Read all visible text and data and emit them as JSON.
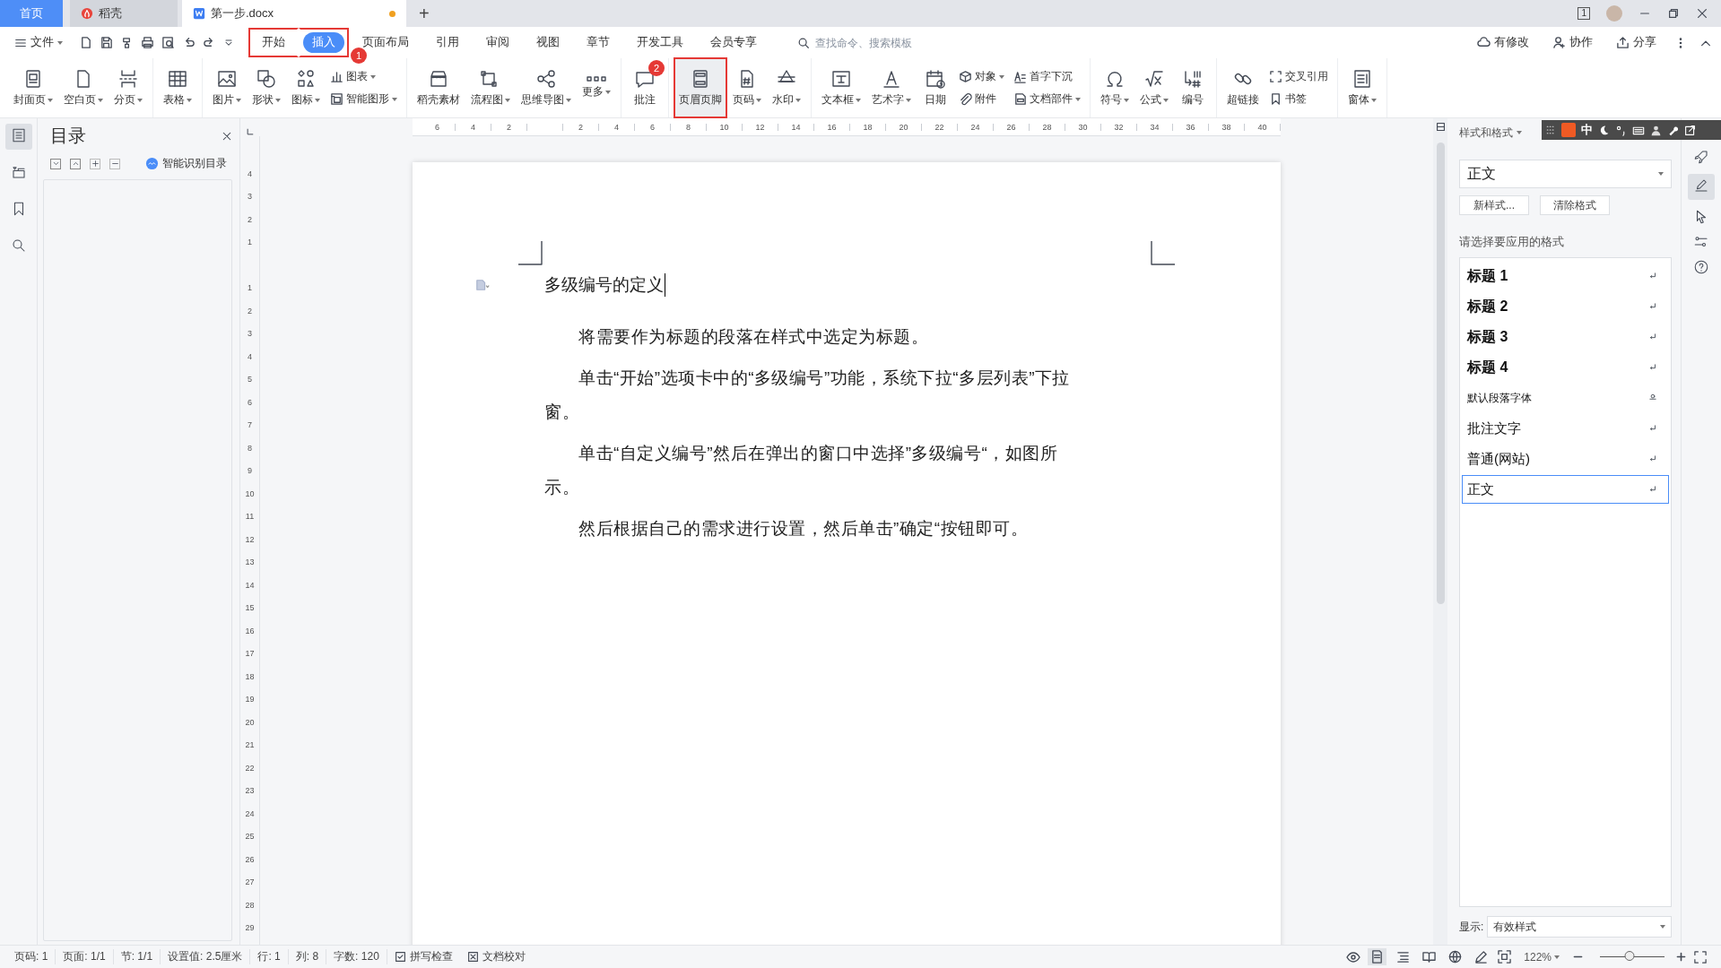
{
  "tabs": [
    {
      "label": "首页",
      "kind": "home",
      "selected": false
    },
    {
      "label": "稻壳",
      "kind": "docer",
      "selected": false
    },
    {
      "label": "第一步.docx",
      "kind": "document",
      "selected": true,
      "unsaved": true
    }
  ],
  "new_tab": "+",
  "window_controls": {
    "badge": "1"
  },
  "menu": {
    "file": "文件",
    "tabs": [
      {
        "label": "开始",
        "selected": false,
        "boxed": true
      },
      {
        "label": "插入",
        "selected": true,
        "boxed": true,
        "badge": "1"
      },
      {
        "label": "页面布局",
        "selected": false,
        "boxed": false
      },
      {
        "label": "引用",
        "selected": false,
        "boxed": false
      },
      {
        "label": "审阅",
        "selected": false,
        "boxed": false
      },
      {
        "label": "视图",
        "selected": false,
        "boxed": false
      },
      {
        "label": "章节",
        "selected": false,
        "boxed": false
      },
      {
        "label": "开发工具",
        "selected": false,
        "boxed": false
      },
      {
        "label": "会员专享",
        "selected": false,
        "boxed": false
      }
    ],
    "search": {
      "placeholder": "查找命令、搜索模板"
    },
    "actions": [
      "有修改",
      "协作",
      "分享"
    ]
  },
  "toolbar": [
    [
      {
        "kind": "large",
        "label": "封面页",
        "dropdown": true,
        "boxed": false
      },
      {
        "kind": "large",
        "label": "空白页",
        "dropdown": true,
        "boxed": false
      },
      {
        "kind": "large",
        "label": "分页",
        "dropdown": true,
        "boxed": false
      }
    ],
    [
      {
        "kind": "large",
        "label": "表格",
        "dropdown": true,
        "boxed": false
      }
    ],
    [
      {
        "kind": "large",
        "label": "图片",
        "dropdown": true,
        "boxed": false
      },
      {
        "kind": "large",
        "label": "形状",
        "dropdown": true,
        "boxed": false
      },
      {
        "kind": "large",
        "label": "图标",
        "dropdown": true,
        "boxed": false
      },
      {
        "kind": "stack",
        "items": [
          {
            "label": "图表",
            "dropdown": true
          },
          {
            "label": "智能图形",
            "dropdown": true
          }
        ]
      }
    ],
    [
      {
        "kind": "large",
        "label": "稻壳素材",
        "dropdown": false,
        "boxed": false
      },
      {
        "kind": "large",
        "label": "流程图",
        "dropdown": true,
        "boxed": false
      },
      {
        "kind": "large",
        "label": "思维导图",
        "dropdown": true,
        "boxed": false
      },
      {
        "kind": "large",
        "label": "更多",
        "dropdown": true,
        "boxed": false
      }
    ],
    [
      {
        "kind": "large",
        "label": "批注",
        "dropdown": false,
        "boxed": false,
        "badge": "2"
      }
    ],
    [
      {
        "kind": "large",
        "label": "页眉页脚",
        "dropdown": false,
        "boxed": true
      },
      {
        "kind": "large",
        "label": "页码",
        "dropdown": true,
        "boxed": false
      },
      {
        "kind": "large",
        "label": "水印",
        "dropdown": true,
        "boxed": false
      }
    ],
    [
      {
        "kind": "large",
        "label": "文本框",
        "dropdown": true,
        "boxed": false
      },
      {
        "kind": "large",
        "label": "艺术字",
        "dropdown": true,
        "boxed": false
      },
      {
        "kind": "large",
        "label": "日期",
        "dropdown": false,
        "boxed": false
      },
      {
        "kind": "stack",
        "items": [
          {
            "label": "对象",
            "dropdown": true
          },
          {
            "label": "附件",
            "dropdown": false
          }
        ]
      },
      {
        "kind": "stack",
        "items": [
          {
            "label": "首字下沉",
            "dropdown": false
          },
          {
            "label": "文档部件",
            "dropdown": true
          }
        ]
      }
    ],
    [
      {
        "kind": "large",
        "label": "符号",
        "dropdown": true,
        "boxed": false
      },
      {
        "kind": "large",
        "label": "公式",
        "dropdown": true,
        "boxed": false
      },
      {
        "kind": "large",
        "label": "编号",
        "dropdown": false,
        "boxed": false
      }
    ],
    [
      {
        "kind": "large",
        "label": "超链接",
        "dropdown": false,
        "boxed": false
      },
      {
        "kind": "stack",
        "items": [
          {
            "label": "交叉引用",
            "dropdown": false
          },
          {
            "label": "书签",
            "dropdown": false
          }
        ]
      }
    ],
    [
      {
        "kind": "large",
        "label": "窗体",
        "dropdown": true,
        "boxed": false
      }
    ]
  ],
  "toc_panel": {
    "title": "目录",
    "smart_button": "智能识别目录"
  },
  "ruler": {
    "left_numbers": [
      "6",
      "4",
      "2"
    ],
    "right_numbers": [
      "2",
      "4",
      "6",
      "8",
      "10",
      "12",
      "14",
      "16",
      "18",
      "20",
      "22",
      "24",
      "26",
      "28",
      "30",
      "32",
      "34",
      "36",
      "38",
      "40"
    ],
    "top_numbers": [
      "4",
      "3",
      "2",
      "1"
    ],
    "body_numbers": [
      "1",
      "2",
      "3",
      "4",
      "5",
      "6",
      "7",
      "8",
      "9",
      "10",
      "11",
      "12",
      "13",
      "14",
      "15",
      "16",
      "17",
      "18",
      "19",
      "20",
      "21",
      "22",
      "23",
      "24",
      "25",
      "26",
      "27",
      "28",
      "29"
    ]
  },
  "document": {
    "title": "多级编号的定义",
    "paragraphs": [
      "将需要作为标题的段落在样式中选定为标题。",
      "单击“开始”选项卡中的“多级编号”功能，系统下拉“多层列表”下拉窗。",
      "单击“自定义编号”然后在弹出的窗口中选择”多级编号“，如图所示。",
      "然后根据自己的需求进行设置，然后单击”确定“按钮即可。"
    ]
  },
  "styles_panel": {
    "title": "样式和格式",
    "current_style": "正文",
    "buttons": [
      "新样式...",
      "清除格式"
    ],
    "prompt": "请选择要应用的格式",
    "styles": [
      {
        "label": "标题 1",
        "kind": "heading",
        "selected": false
      },
      {
        "label": "标题 2",
        "kind": "heading",
        "selected": false
      },
      {
        "label": "标题 3",
        "kind": "heading",
        "selected": false
      },
      {
        "label": "标题 4",
        "kind": "heading",
        "selected": false
      },
      {
        "label": "默认段落字体",
        "kind": "character",
        "selected": false
      },
      {
        "label": "批注文字",
        "kind": "paragraph",
        "selected": false
      },
      {
        "label": "普通(网站)",
        "kind": "paragraph",
        "selected": false
      },
      {
        "label": "正文",
        "kind": "paragraph",
        "selected": true
      }
    ],
    "show_label": "显示:",
    "show_value": "有效样式"
  },
  "ime_bar": {
    "mode": "中"
  },
  "status_bar": {
    "items": [
      "页码: 1",
      "页面: 1/1",
      "节: 1/1",
      "设置值: 2.5厘米",
      "行: 1",
      "列: 8",
      "字数: 120"
    ],
    "checks": [
      "拼写检查",
      "文档校对"
    ],
    "view_modes": [
      {
        "selected": true
      },
      {
        "selected": false
      },
      {
        "selected": false
      },
      {
        "selected": false
      },
      {
        "selected": false
      }
    ],
    "zoom": "122%",
    "zoom_slider": {
      "level": 0.46
    }
  }
}
